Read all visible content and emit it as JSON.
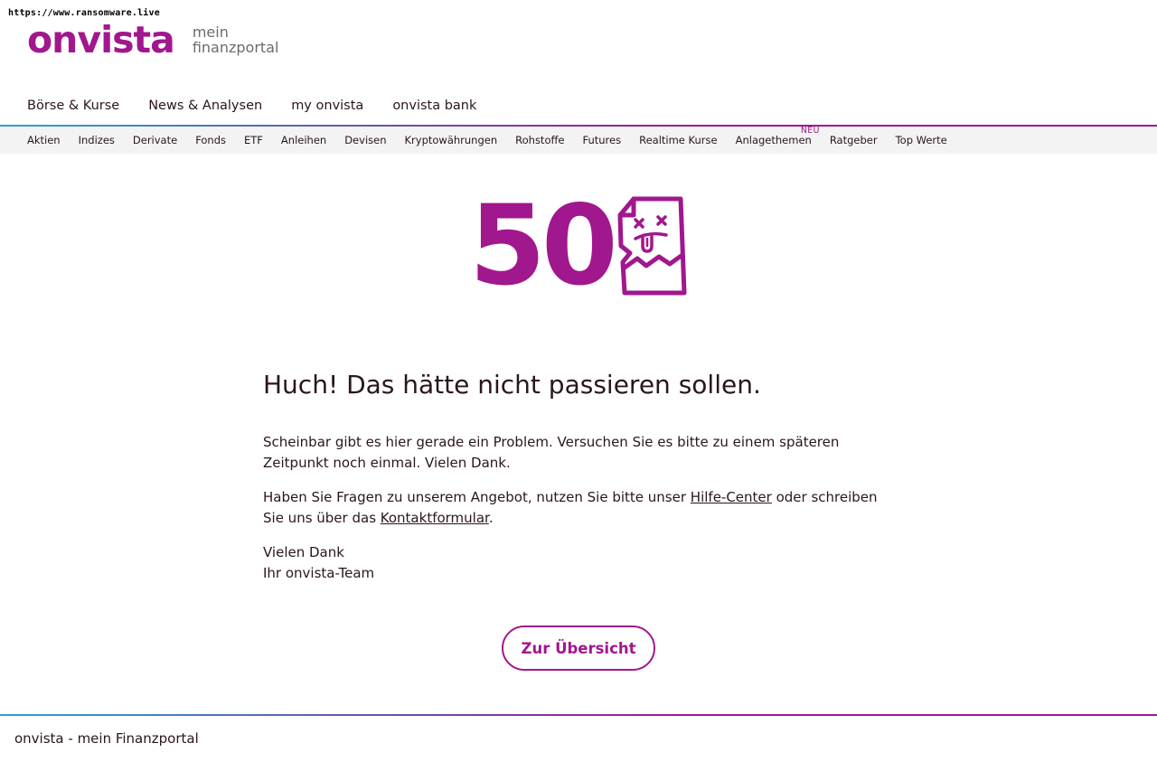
{
  "url_label": "https://www.ransomware.live",
  "logo": {
    "wordmark": "onvista",
    "tagline_line1": "mein",
    "tagline_line2": "finanzportal"
  },
  "main_nav": [
    {
      "label": "Börse & Kurse"
    },
    {
      "label": "News & Analysen"
    },
    {
      "label": "my onvista"
    },
    {
      "label": "onvista bank"
    }
  ],
  "sub_nav": [
    {
      "label": "Aktien"
    },
    {
      "label": "Indizes"
    },
    {
      "label": "Derivate"
    },
    {
      "label": "Fonds"
    },
    {
      "label": "ETF"
    },
    {
      "label": "Anleihen"
    },
    {
      "label": "Devisen"
    },
    {
      "label": "Kryptowährungen"
    },
    {
      "label": "Rohstoffe"
    },
    {
      "label": "Futures"
    },
    {
      "label": "Realtime Kurse"
    },
    {
      "label": "Anlagethemen",
      "badge": "NEU"
    },
    {
      "label": "Ratgeber"
    },
    {
      "label": "Top Werte"
    }
  ],
  "error": {
    "code": "50",
    "icon": "broken-document-icon",
    "heading": "Huch! Das hätte nicht passieren sollen.",
    "paragraph1": "Scheinbar gibt es hier gerade ein Problem. Versuchen Sie es bitte zu einem späteren Zeitpunkt noch einmal. Vielen Dank.",
    "paragraph2_part1": "Haben Sie Fragen zu unserem Angebot, nutzen Sie bitte unser ",
    "help_link": "Hilfe-Center",
    "paragraph2_part2": " oder schreiben Sie uns über das ",
    "contact_link": "Kontaktformular",
    "paragraph2_part3": ".",
    "signoff_line1": "Vielen Dank",
    "signoff_line2": "Ihr onvista-Team"
  },
  "cta_label": "Zur Übersicht",
  "footer_text": "onvista - mein Finanzportal",
  "colors": {
    "brand": "#a1178e",
    "text": "#2a1520",
    "subnav_bg": "#f3f3f3",
    "gradient_start": "#2fa0d2"
  }
}
